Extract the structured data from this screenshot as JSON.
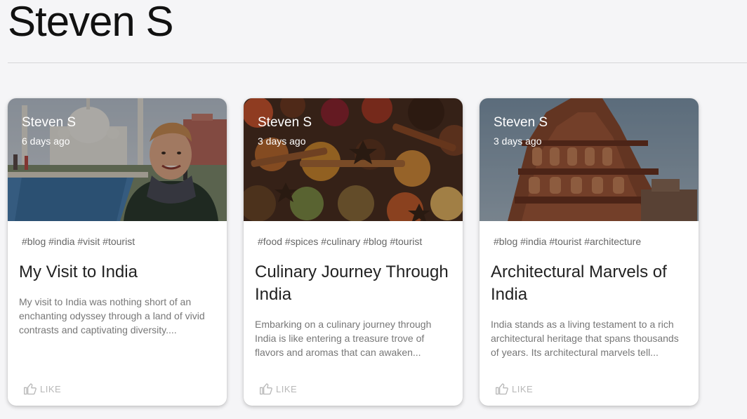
{
  "author": {
    "name": "Steven S"
  },
  "posts": [
    {
      "author": "Steven S",
      "date": "6 days ago",
      "tags": "#blog #india #visit #tourist",
      "title": "My Visit to India",
      "excerpt": "My visit to India was nothing short of an enchanting odyssey through a land of vivid contrasts and captivating diversity....",
      "like_label": "LIKE",
      "image_icon": "taj-mahal-photo"
    },
    {
      "author": "Steven S",
      "date": "3 days ago",
      "tags": "#food #spices #culinary #blog #tourist",
      "title": "Culinary Journey Through India",
      "excerpt": "Embarking on a culinary journey through India is like entering a treasure trove of flavors and aromas that can awaken...",
      "like_label": "LIKE",
      "image_icon": "spices-photo"
    },
    {
      "author": "Steven S",
      "date": "3 days ago",
      "tags": "#blog #india #tourist #architecture",
      "title": "Architectural Marvels of India",
      "excerpt": "India stands as a living testament to a rich architectural heritage that spans thousands of years. Its architectural marvels tell...",
      "like_label": "LIKE",
      "image_icon": "minaret-photo"
    }
  ],
  "colors": {
    "background": "#f5f5f7",
    "card": "#ffffff",
    "muted_text": "#777777",
    "like_text": "#b8b8b8"
  }
}
